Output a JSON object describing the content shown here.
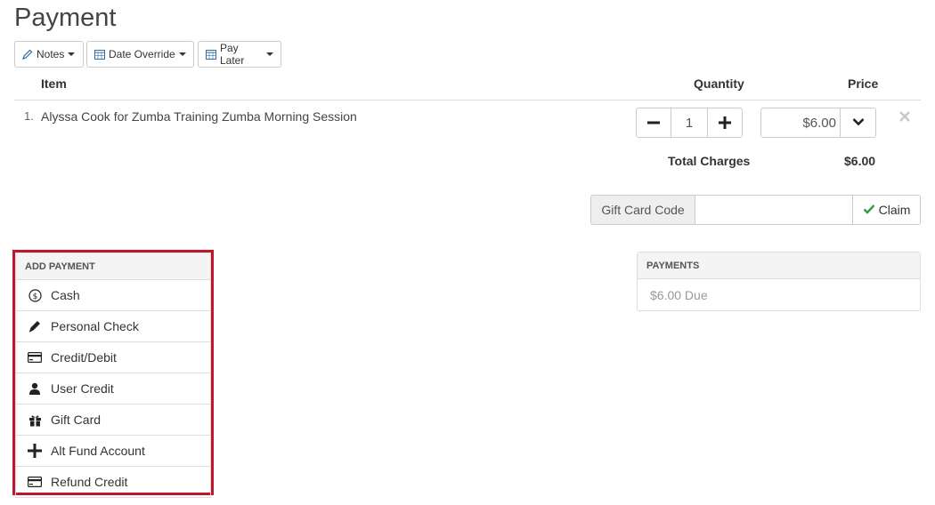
{
  "page": {
    "title": "Payment"
  },
  "toolbar": {
    "notes_label": "Notes",
    "date_override_label": "Date Override",
    "pay_later_label": "Pay Later"
  },
  "table": {
    "headers": {
      "item": "Item",
      "quantity": "Quantity",
      "price": "Price"
    },
    "rows": [
      {
        "num": "1.",
        "item": "Alyssa Cook for Zumba Training Zumba Morning Session",
        "quantity": "1",
        "price": "$6.00"
      }
    ],
    "total_label": "Total Charges",
    "total_value": "$6.00"
  },
  "gift_card": {
    "label": "Gift Card Code",
    "value": "",
    "claim_label": "Claim"
  },
  "add_payment": {
    "header": "ADD PAYMENT",
    "items": [
      {
        "label": "Cash",
        "icon": "dollar-circle-icon"
      },
      {
        "label": "Personal Check",
        "icon": "pen-icon"
      },
      {
        "label": "Credit/Debit",
        "icon": "credit-card-icon"
      },
      {
        "label": "User Credit",
        "icon": "user-icon"
      },
      {
        "label": "Gift Card",
        "icon": "gift-icon"
      },
      {
        "label": "Alt Fund Account",
        "icon": "plus-icon"
      },
      {
        "label": "Refund Credit",
        "icon": "credit-card-icon"
      }
    ]
  },
  "payments": {
    "header": "PAYMENTS",
    "due_text": "$6.00 Due"
  },
  "colors": {
    "highlight_border": "#c0152f",
    "check_green": "#3c9a3c",
    "calendar_blue": "#2e6da4"
  }
}
